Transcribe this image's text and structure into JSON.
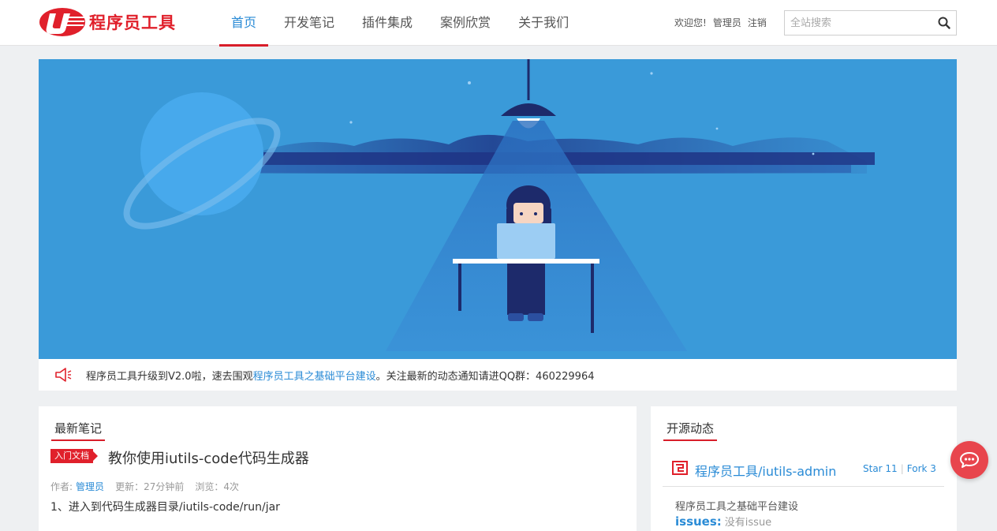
{
  "header": {
    "brand_text": "程序员工具",
    "nav": [
      {
        "label": "首页",
        "active": true
      },
      {
        "label": "开发笔记",
        "active": false
      },
      {
        "label": "插件集成",
        "active": false
      },
      {
        "label": "案例欣赏",
        "active": false
      },
      {
        "label": "关于我们",
        "active": false
      }
    ],
    "welcome": "欢迎您!",
    "username": "管理员",
    "logout": "注销",
    "search_placeholder": "全站搜索",
    "search_icon": "search-icon"
  },
  "notice": {
    "icon": "megaphone-icon",
    "text_before": "程序员工具升级到V2.0啦，速去围观",
    "link_text": "程序员工具之基础平台建设",
    "text_after": "。关注最新的动态通知请进QQ群：460229964"
  },
  "latest_notes": {
    "section_title": "最新笔记",
    "tag": "入门文档",
    "post_title": "教你使用iutils-code代码生成器",
    "meta_author_label": "作者:",
    "meta_author": "管理员",
    "meta_updated": "更新：27分钟前",
    "meta_views": "浏览：4次",
    "excerpt": "1、进入到代码生成器目录/iutils-code/run/jar"
  },
  "open_source": {
    "section_title": "开源动态",
    "repo_name": "程序员工具/iutils-admin",
    "star": "Star 11",
    "fork": "Fork 3",
    "repo_desc": "程序员工具之基础平台建设",
    "issues_label": "issues:",
    "issues_value": "没有issue"
  },
  "colors": {
    "brand_red": "#e0202b",
    "link_blue": "#2a8bd6",
    "banner_blue": "#3a9ad9",
    "chat_red": "#e8454d"
  },
  "chat_icon": "chat-bubble-icon"
}
